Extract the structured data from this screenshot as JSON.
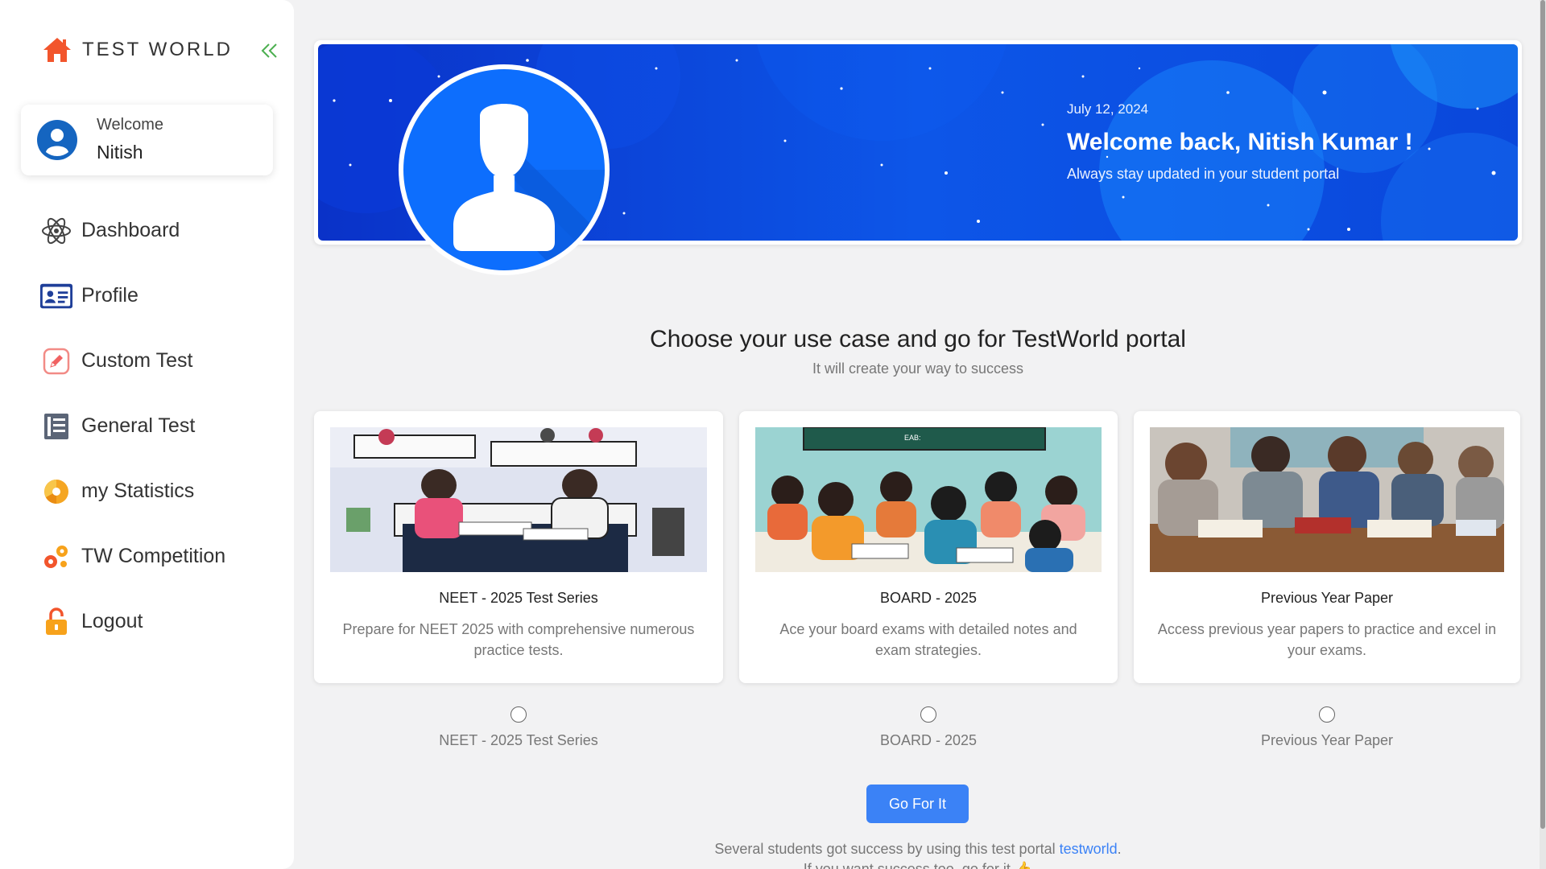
{
  "sidebar": {
    "brand": "TEST WORLD",
    "welcome_label": "Welcome",
    "welcome_name": "Nitish",
    "items": [
      {
        "label": "Dashboard",
        "icon": "atom-icon"
      },
      {
        "label": "Profile",
        "icon": "id-card-icon"
      },
      {
        "label": "Custom Test",
        "icon": "edit-icon"
      },
      {
        "label": "General Test",
        "icon": "list-icon"
      },
      {
        "label": "my Statistics",
        "icon": "pie-chart-icon"
      },
      {
        "label": "TW Competition",
        "icon": "gears-icon"
      },
      {
        "label": "Logout",
        "icon": "unlock-icon"
      }
    ]
  },
  "banner": {
    "date": "July 12, 2024",
    "title": "Welcome back, Nitish Kumar !",
    "subtitle": "Always stay updated in your student portal"
  },
  "main": {
    "title": "Choose your use case and go for TestWorld portal",
    "subtitle": "It will create your way to success",
    "cards": [
      {
        "title": "NEET - 2025 Test Series",
        "desc": "Prepare for NEET 2025 with comprehensive numerous practice tests.",
        "option": "NEET - 2025 Test Series"
      },
      {
        "title": "BOARD - 2025",
        "desc": "Ace your board exams with detailed notes and exam strategies.",
        "option": "BOARD - 2025"
      },
      {
        "title": "Previous Year Paper",
        "desc": "Access previous year papers to practice and excel in your exams.",
        "option": "Previous Year Paper"
      }
    ],
    "button": "Go For It",
    "footer_text": "Several students got success by using this test portal ",
    "footer_link": "testworld",
    "footer_end": ".",
    "footer_line2": "If you want success too, go for it 👍"
  },
  "colors": {
    "accent": "#3b82f6",
    "brand_icon": "#f2552c",
    "banner_blue": "#0d56e8"
  }
}
